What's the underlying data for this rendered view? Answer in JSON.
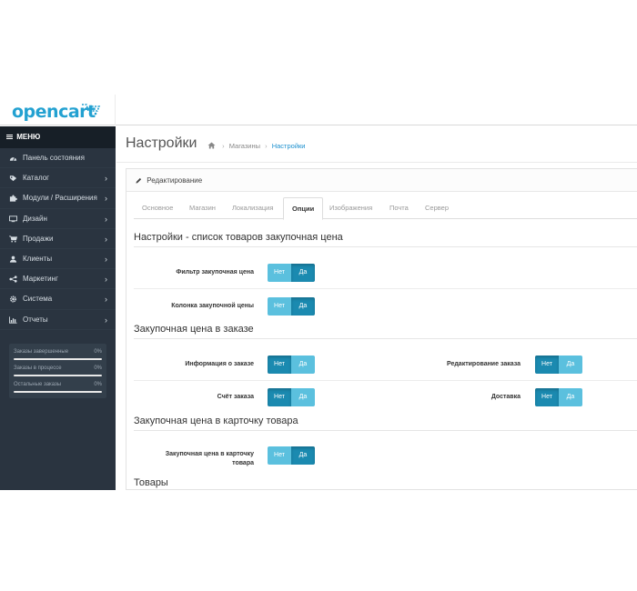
{
  "header": {
    "logo": "opencart"
  },
  "sidebar": {
    "menu_title": "МЕНЮ",
    "items": [
      {
        "label": "Панель состояния",
        "icon": "dashboard-icon",
        "has_children": false
      },
      {
        "label": "Каталог",
        "icon": "tag-icon",
        "has_children": true
      },
      {
        "label": "Модули / Расширения",
        "icon": "puzzle-icon",
        "has_children": true
      },
      {
        "label": "Дизайн",
        "icon": "monitor-icon",
        "has_children": true
      },
      {
        "label": "Продажи",
        "icon": "cart-icon",
        "has_children": true
      },
      {
        "label": "Клиенты",
        "icon": "user-icon",
        "has_children": true
      },
      {
        "label": "Маркетинг",
        "icon": "share-icon",
        "has_children": true
      },
      {
        "label": "Система",
        "icon": "gear-icon",
        "has_children": true
      },
      {
        "label": "Отчеты",
        "icon": "bar-chart-icon",
        "has_children": true
      }
    ],
    "chevron": "›",
    "stats": [
      {
        "label": "Заказы завершенные",
        "percent": "0%"
      },
      {
        "label": "Заказы в процессе",
        "percent": "0%"
      },
      {
        "label": "Остальные заказы",
        "percent": "0%"
      }
    ]
  },
  "main": {
    "title": "Настройки",
    "breadcrumb": {
      "separator": "›",
      "items": [
        "Магазины",
        "Настройки"
      ]
    },
    "panel_title": "Редактирование",
    "tabs": [
      "Основное",
      "Магазин",
      "Локализация",
      "Опции",
      "Изображения",
      "Почта",
      "Сервер"
    ],
    "active_tab": "Опции",
    "toggle_labels": {
      "no": "Нет",
      "yes": "Да"
    },
    "sections": {
      "s1": {
        "title": "Настройки - список товаров закупочная цена",
        "fields": {
          "filter": {
            "label": "Фильтр закупочная цена",
            "value": "Да"
          },
          "column": {
            "label": "Колонка закупочной цены",
            "value": "Да"
          }
        }
      },
      "s2": {
        "title": "Закупочная цена в заказе",
        "fields": {
          "order_info": {
            "label": "Информация о заказе",
            "value": "Нет"
          },
          "order_edit": {
            "label": "Редактирование заказа",
            "value": "Нет"
          },
          "invoice": {
            "label": "Счёт заказа",
            "value": "Нет"
          },
          "shipping": {
            "label": "Доставка",
            "value": "Нет"
          }
        }
      },
      "s3": {
        "title": "Закупочная цена в карточку товара",
        "fields": {
          "product_card": {
            "label": "Закупочная цена в карточку товара",
            "value": "Да"
          }
        }
      },
      "s4": {
        "title": "Товары"
      }
    },
    "colors": {
      "toggle_light": "#5bc0de",
      "toggle_dark": "#1b8ab0",
      "sidebar": "#2a3440",
      "brand": "#23a1d1"
    }
  }
}
